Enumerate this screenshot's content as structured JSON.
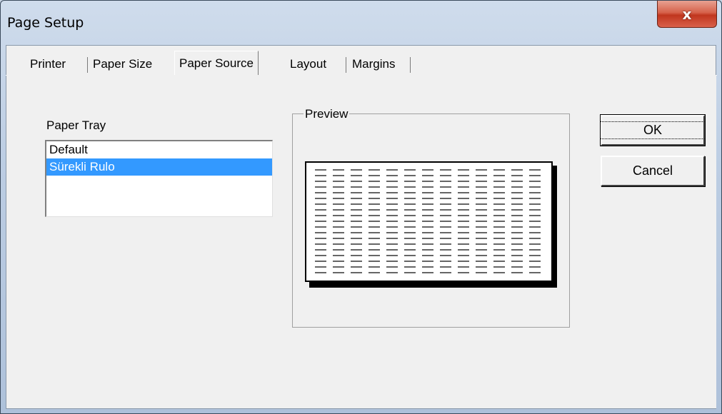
{
  "window": {
    "title": "Page Setup",
    "close_label": "x"
  },
  "tabs": [
    {
      "label": "Printer"
    },
    {
      "label": "Paper Size"
    },
    {
      "label": "Paper Source",
      "active": true
    },
    {
      "label": "Layout"
    },
    {
      "label": "Margins"
    }
  ],
  "paper_source": {
    "tray_label": "Paper Tray",
    "tray_items": [
      {
        "label": "Default",
        "selected": false
      },
      {
        "label": "Sürekli Rulo",
        "selected": true
      }
    ],
    "preview_label": "Preview"
  },
  "buttons": {
    "ok_label": "OK",
    "cancel_label": "Cancel"
  },
  "colors": {
    "selection": "#3399ff",
    "close_button": "#c0361e",
    "dialog_background": "#f0f0f0"
  }
}
